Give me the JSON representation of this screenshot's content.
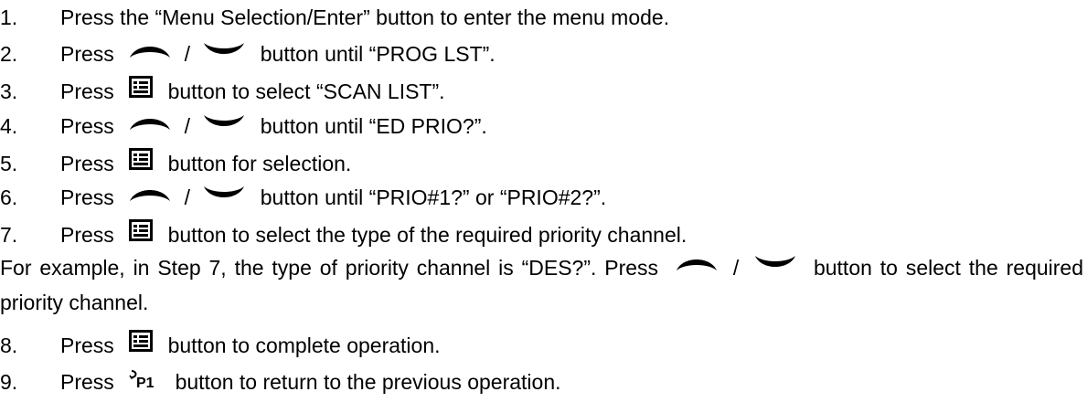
{
  "steps": [
    {
      "num": "1.",
      "pre": "Press the “Menu Selection/Enter” button to enter the menu mode.",
      "post": ""
    },
    {
      "num": "2.",
      "pre": "Press",
      "sep": "/",
      "post": "button until “PROG LST”."
    },
    {
      "num": "3.",
      "pre": "Press",
      "post": "button to select “SCAN LIST”."
    },
    {
      "num": "4.",
      "pre": "Press",
      "sep": "/",
      "post": "button until “ED PRIO?”."
    },
    {
      "num": "5.",
      "pre": "Press",
      "post": "button for selection."
    },
    {
      "num": "6.",
      "pre": "Press",
      "sep": "/",
      "post": "button until “PRIO#1?” or “PRIO#2?”."
    },
    {
      "num": "7.",
      "pre": "Press",
      "post": "button to select the type of the required priority channel."
    },
    {
      "num": "8.",
      "pre": "Press",
      "post": "button to complete operation."
    },
    {
      "num": "9.",
      "pre": "Press",
      "post": "button to return to the previous operation."
    }
  ],
  "note": {
    "pre": "For example, in Step 7, the type of priority channel is “DES?”. Press",
    "sep": "/",
    "post": "button to select the required priority channel."
  },
  "icons": {
    "up": "up-arc-icon",
    "down": "down-arc-icon",
    "menu": "menu-enter-icon",
    "p1": "p1-back-icon",
    "p1_text": "P1"
  }
}
